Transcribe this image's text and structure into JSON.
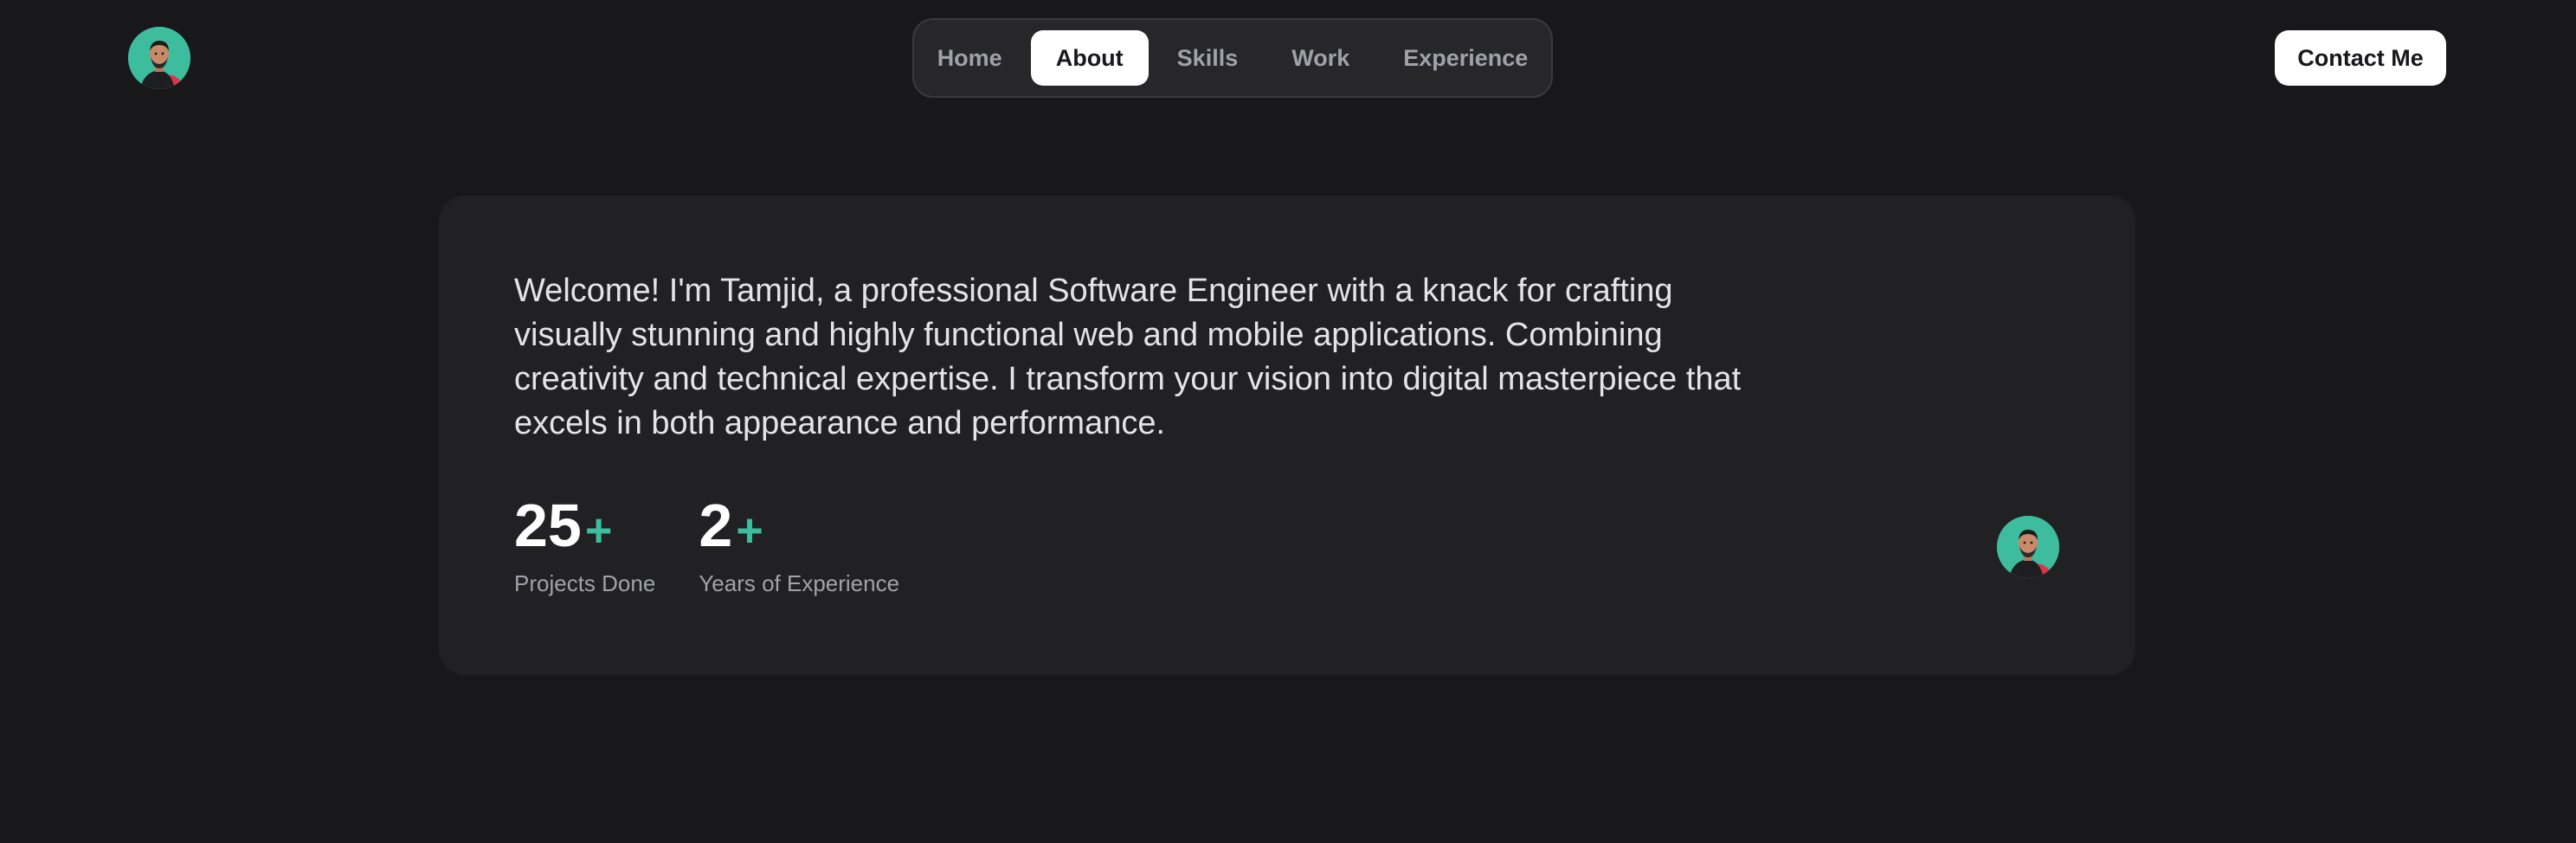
{
  "header": {
    "logo_icon": "profile-avatar",
    "nav": [
      {
        "label": "Home",
        "active": false
      },
      {
        "label": "About",
        "active": true
      },
      {
        "label": "Skills",
        "active": false
      },
      {
        "label": "Work",
        "active": false
      },
      {
        "label": "Experience",
        "active": false
      }
    ],
    "contact_label": "Contact Me"
  },
  "about": {
    "intro": "Welcome! I'm Tamjid, a professional Software Engineer with a knack for crafting visually stunning and highly functional web and mobile applications. Combining creativity and technical expertise. I transform your vision into digital masterpiece that excels in both appearance and performance.",
    "stats": [
      {
        "value": "25",
        "suffix": "+",
        "label": "Projects Done"
      },
      {
        "value": "2",
        "suffix": "+",
        "label": "Years of Experience"
      }
    ],
    "avatar_icon": "profile-avatar"
  },
  "colors": {
    "background": "#18181b",
    "card": "#212124",
    "accent": "#3dbc9e",
    "nav_active_bg": "#ffffff"
  }
}
